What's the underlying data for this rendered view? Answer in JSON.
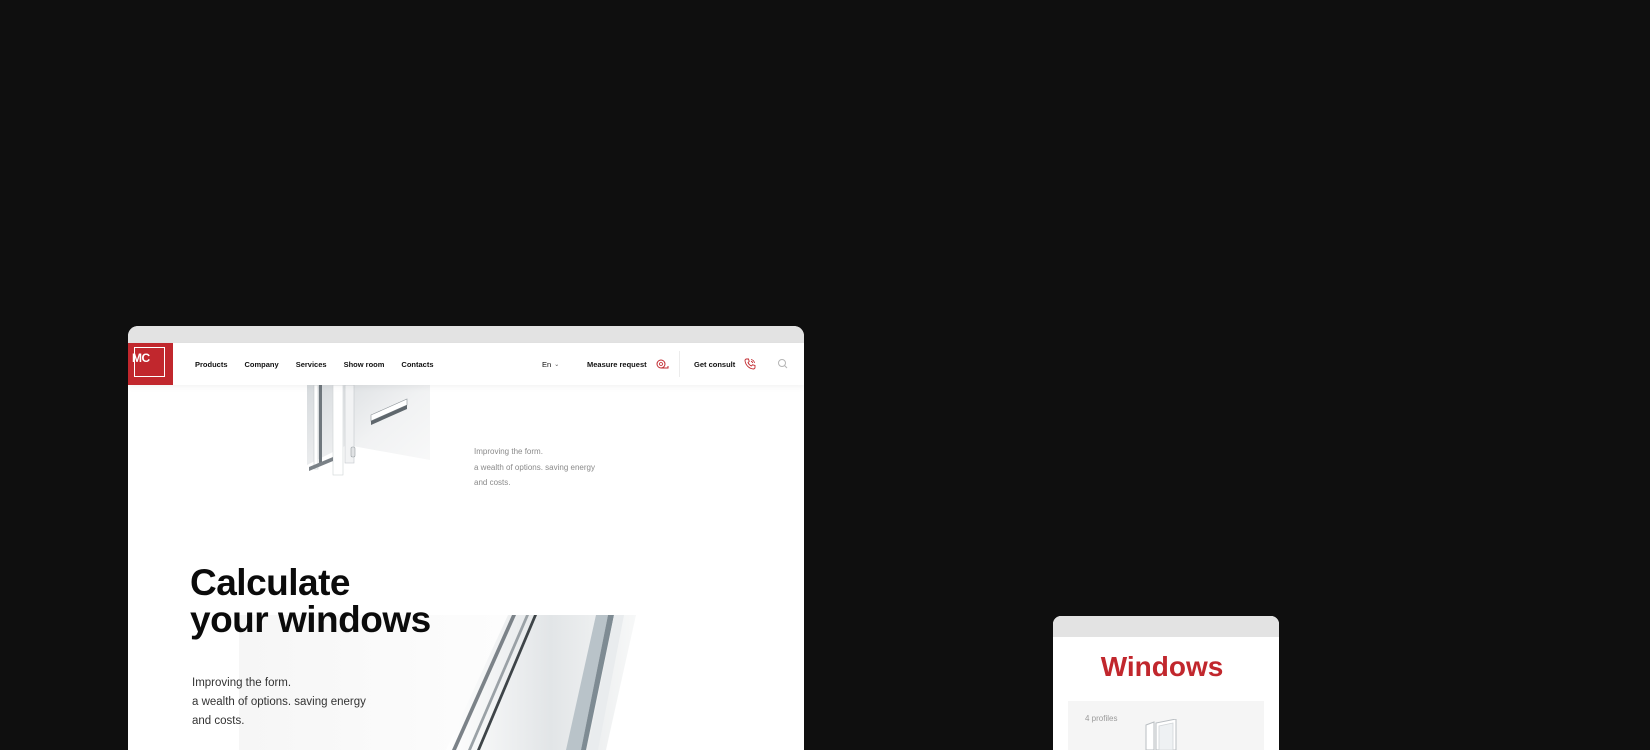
{
  "header": {
    "logo_text": "MC",
    "nav": [
      {
        "label": "Products"
      },
      {
        "label": "Company"
      },
      {
        "label": "Services"
      },
      {
        "label": "Show room"
      },
      {
        "label": "Contacts"
      }
    ],
    "language": "En",
    "measure_request": "Measure request",
    "get_consult": "Get consult"
  },
  "section_intro": {
    "description": [
      "Improving the form.",
      "a wealth of options. saving energy",
      "and costs."
    ]
  },
  "hero": {
    "title": [
      "Calculate",
      "your windows"
    ],
    "description": [
      "Improving the form.",
      "a wealth of options. saving energy",
      "and costs."
    ]
  },
  "mobile": {
    "title": "Windows",
    "card_label": "4 profiles"
  },
  "colors": {
    "background": "#0f0f0f",
    "accent": "#c1272d",
    "browser_bar": "#e3e3e3"
  },
  "icons": {
    "measure": "tape-measure-icon",
    "consult": "phone-icon",
    "search": "search-icon",
    "language": "chevron-down-icon"
  }
}
